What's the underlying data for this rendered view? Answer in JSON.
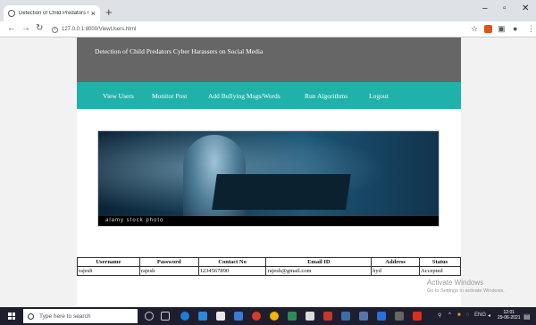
{
  "browser": {
    "tab_title": "Detection of Child Predators Cyb",
    "url": "127.0.0.1:8000/ViewUsers.html"
  },
  "site": {
    "title": "Detection of Child Predators Cyber Harassers on Social Media"
  },
  "menu": [
    {
      "label": "View Users"
    },
    {
      "label": "Monitor Post"
    },
    {
      "label": "Add Bullying Msgs/Words"
    },
    {
      "label": "Run Algorithms"
    },
    {
      "label": "Logout"
    }
  ],
  "photo": {
    "watermark": "alamy stock photo"
  },
  "users_table": {
    "headers": [
      "Username",
      "Password",
      "Contact No",
      "Email ID",
      "Address",
      "Status"
    ],
    "rows": [
      [
        "rajesh",
        "rajesh",
        "1234567890",
        "rajesh@gmail.com",
        "hyd",
        "Accepted"
      ]
    ]
  },
  "windows": {
    "activate_title": "Activate Windows",
    "activate_hint": "Go to Settings to activate Windows.",
    "search_placeholder": "Type here to search",
    "clock_time": "12:01",
    "clock_date": "29-06-2021",
    "tray_lang": "ENG"
  }
}
